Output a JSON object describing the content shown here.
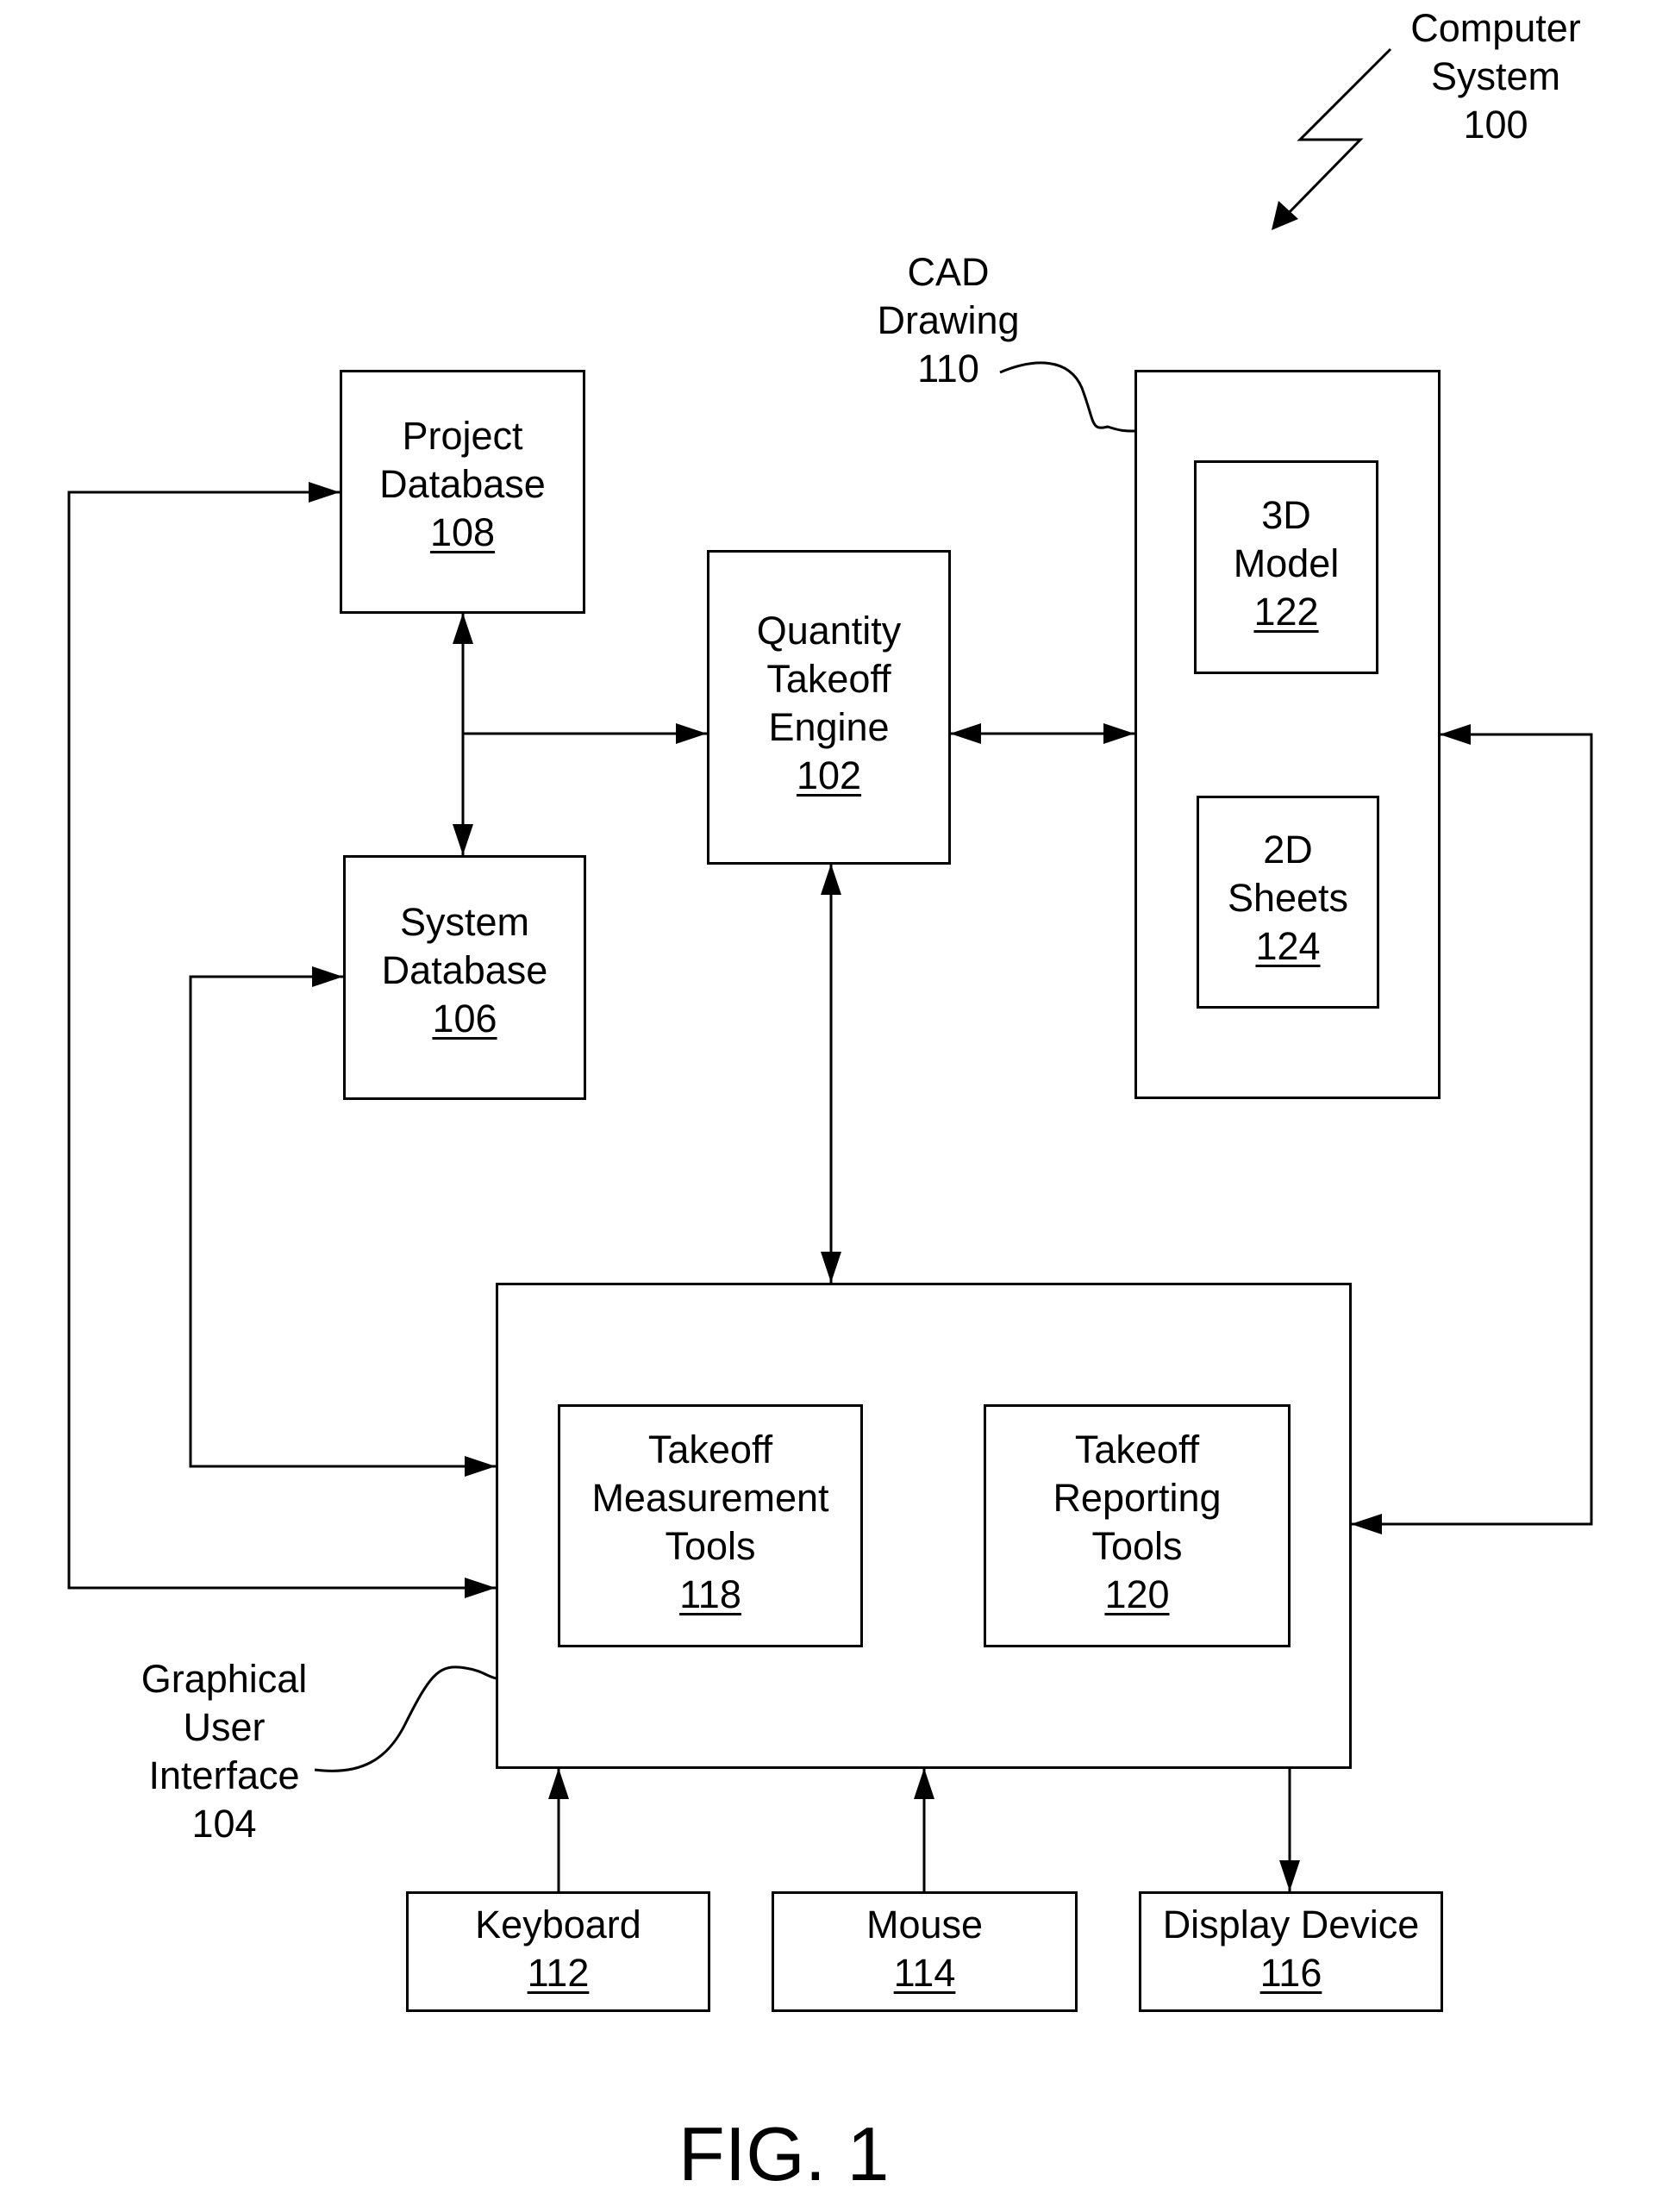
{
  "figure": {
    "caption": "FIG. 1",
    "system_label": {
      "lines": [
        "Computer",
        "System"
      ],
      "ref": "100"
    }
  },
  "blocks": {
    "project_database": {
      "lines": [
        "Project",
        "Database"
      ],
      "ref": "108"
    },
    "system_database": {
      "lines": [
        "System",
        "Database"
      ],
      "ref": "106"
    },
    "quantity_takeoff_engine": {
      "lines": [
        "Quantity",
        "Takeoff",
        "Engine"
      ],
      "ref": "102"
    },
    "cad_drawing": {
      "lines": [
        "CAD",
        "Drawing"
      ],
      "ref": "110"
    },
    "model_3d": {
      "lines": [
        "3D",
        "Model"
      ],
      "ref": "122"
    },
    "sheets_2d": {
      "lines": [
        "2D",
        "Sheets"
      ],
      "ref": "124"
    },
    "graphical_user_interface": {
      "lines": [
        "Graphical",
        "User",
        "Interface"
      ],
      "ref": "104"
    },
    "takeoff_measurement_tools": {
      "lines": [
        "Takeoff",
        "Measurement",
        "Tools"
      ],
      "ref": "118"
    },
    "takeoff_reporting_tools": {
      "lines": [
        "Takeoff",
        "Reporting",
        "Tools"
      ],
      "ref": "120"
    },
    "keyboard": {
      "lines": [
        "Keyboard"
      ],
      "ref": "112"
    },
    "mouse": {
      "lines": [
        "Mouse"
      ],
      "ref": "114"
    },
    "display_device": {
      "lines": [
        "Display Device"
      ],
      "ref": "116"
    }
  },
  "connections": [
    {
      "from": "project_database",
      "to": "system_database",
      "direction": "bidirectional"
    },
    {
      "from": "project_database",
      "to": "quantity_takeoff_engine",
      "direction": "forward"
    },
    {
      "from": "quantity_takeoff_engine",
      "to": "cad_drawing",
      "direction": "bidirectional"
    },
    {
      "from": "quantity_takeoff_engine",
      "to": "graphical_user_interface",
      "direction": "bidirectional"
    },
    {
      "from": "graphical_user_interface",
      "to": "project_database",
      "direction": "bidirectional"
    },
    {
      "from": "graphical_user_interface",
      "to": "system_database",
      "direction": "bidirectional"
    },
    {
      "from": "graphical_user_interface",
      "to": "cad_drawing",
      "direction": "bidirectional"
    },
    {
      "from": "keyboard",
      "to": "graphical_user_interface",
      "direction": "forward"
    },
    {
      "from": "mouse",
      "to": "graphical_user_interface",
      "direction": "forward"
    },
    {
      "from": "graphical_user_interface",
      "to": "display_device",
      "direction": "forward"
    }
  ]
}
